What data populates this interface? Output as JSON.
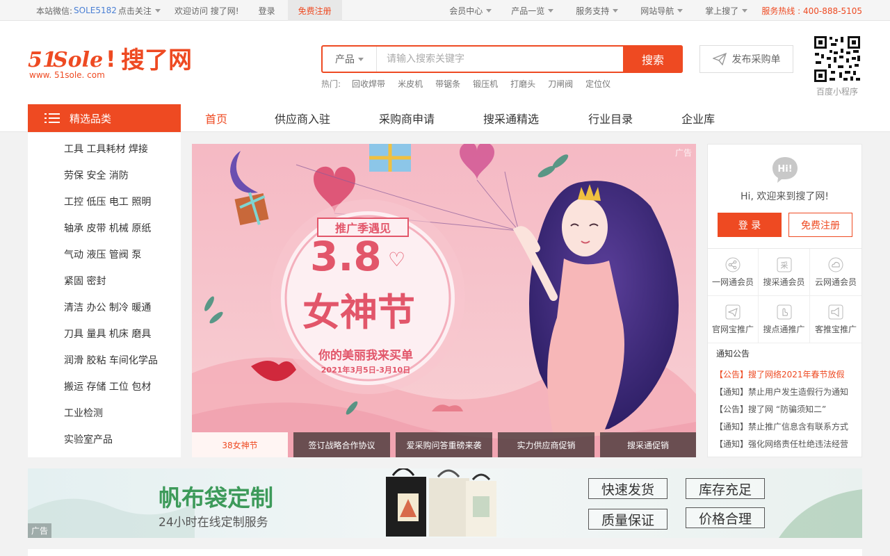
{
  "topbar": {
    "wechat_label": "本站微信:",
    "wechat_id": "SOLE5182",
    "follow": "点击关注",
    "welcome": "欢迎访问 搜了网!",
    "login": "登录",
    "register": "免费注册",
    "right_items": [
      "会员中心",
      "产品一览",
      "服务支持",
      "网站导航",
      "掌上搜了"
    ],
    "hotline": "服务热线 : 400-888-5105"
  },
  "logo": {
    "brand": "51Sole!搜了网",
    "url_text": "www. 51sole. com"
  },
  "search": {
    "category": "产品",
    "placeholder": "请输入搜索关键字",
    "button": "搜索",
    "hot_label": "热门:",
    "hot_words": [
      "回收焊带",
      "米皮机",
      "带锯条",
      "锻压机",
      "打磨头",
      "刀闸阀",
      "定位仪"
    ]
  },
  "publish_button": "发布采购单",
  "qr_caption": "百度小程序",
  "nav": {
    "category_head": "精选品类",
    "links": [
      "首页",
      "供应商入驻",
      "采购商申请",
      "搜采通精选",
      "行业目录",
      "企业库"
    ],
    "active_index": 0
  },
  "categories": [
    "工具 工具耗材 焊接",
    "劳保 安全 消防",
    "工控 低压 电工 照明",
    "轴承 皮带 机械 原纸",
    "气动 液压 管阀 泵",
    "紧固 密封",
    "清洁 办公 制冷 暖通",
    "刀具 量具 机床 磨具",
    "润滑 胶粘 车间化学品",
    "搬运 存储 工位 包材",
    "工业检测",
    "实验室产品"
  ],
  "banner": {
    "ad_tag": "广告",
    "ribbon": "推广季遇见",
    "big_number": "3.8",
    "headline": "女神节",
    "subline": "你的美丽我来买单",
    "date": "2021年3月5日-3月10日",
    "thumbs": [
      "38女神节",
      "签订战略合作协议",
      "爱采购问答重磅来袭",
      "实力供应商促销",
      "搜采通促销"
    ]
  },
  "sidebar": {
    "hi_badge": "Hi!",
    "welcome": "Hi,  欢迎来到搜了网!",
    "login": "登 录",
    "register": "免费注册",
    "services": [
      {
        "label": "一网通会员",
        "icon": "share-icon"
      },
      {
        "label": "搜采通会员",
        "icon": "purchase-icon"
      },
      {
        "label": "云网通会员",
        "icon": "cloud-icon"
      },
      {
        "label": "官网宝推广",
        "icon": "send-icon"
      },
      {
        "label": "搜点通推广",
        "icon": "tap-icon"
      },
      {
        "label": "客推宝推广",
        "icon": "megaphone-icon"
      }
    ],
    "notice_title": "通知公告",
    "notices": [
      {
        "tag": "【公告】",
        "text": "搜了网络2021年春节放假"
      },
      {
        "tag": "【通知】",
        "text": "禁止用户发生造假行为通知"
      },
      {
        "tag": "【公告】",
        "text": "搜了网 “防骗须知二”"
      },
      {
        "tag": "【通知】",
        "text": "禁止推广信息含有联系方式"
      },
      {
        "tag": "【通知】",
        "text": "强化网络责任杜绝违法经营"
      }
    ]
  },
  "ad_bar": {
    "title": "帆布袋定制",
    "subtitle": "24小时在线定制服务",
    "tags": [
      "快速发货",
      "库存充足",
      "质量保证",
      "价格合理"
    ],
    "ad_tag": "广告"
  },
  "colors": {
    "accent": "#ee4a22",
    "link_blue": "#4a7fd4",
    "green": "#3d9a5a"
  }
}
